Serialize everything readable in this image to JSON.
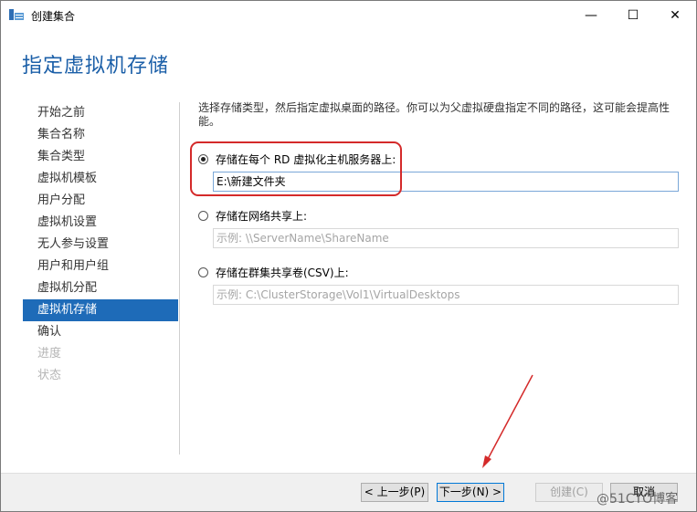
{
  "window": {
    "title": "创建集合",
    "minimize_glyph": "—",
    "maximize_glyph": "☐",
    "close_glyph": "✕"
  },
  "page_title": "指定虚拟机存储",
  "nav": {
    "items": [
      {
        "label": "开始之前",
        "state": "normal"
      },
      {
        "label": "集合名称",
        "state": "normal"
      },
      {
        "label": "集合类型",
        "state": "normal"
      },
      {
        "label": "虚拟机模板",
        "state": "normal"
      },
      {
        "label": "用户分配",
        "state": "normal"
      },
      {
        "label": "虚拟机设置",
        "state": "normal"
      },
      {
        "label": "无人参与设置",
        "state": "normal"
      },
      {
        "label": "用户和用户组",
        "state": "normal"
      },
      {
        "label": "虚拟机分配",
        "state": "normal"
      },
      {
        "label": "虚拟机存储",
        "state": "active"
      },
      {
        "label": "确认",
        "state": "normal"
      },
      {
        "label": "进度",
        "state": "disabled"
      },
      {
        "label": "状态",
        "state": "disabled"
      }
    ]
  },
  "content": {
    "description": "选择存储类型，然后指定虚拟桌面的路径。你可以为父虚拟硬盘指定不同的路径，这可能会提高性能。",
    "option_local": {
      "label": "存储在每个 RD 虚拟化主机服务器上:",
      "value": "E:\\新建文件夹",
      "checked": true
    },
    "option_share": {
      "label": "存储在网络共享上:",
      "placeholder": "示例: \\\\ServerName\\ShareName",
      "checked": false
    },
    "option_csv": {
      "label": "存储在群集共享卷(CSV)上:",
      "placeholder": "示例: C:\\ClusterStorage\\Vol1\\VirtualDesktops",
      "checked": false
    }
  },
  "buttons": {
    "prev": "< 上一步(P)",
    "next": "下一步(N) >",
    "create": "创建(C)",
    "cancel": "取消"
  },
  "watermark": "@51CTO博客",
  "colors": {
    "accent": "#1e6bb8",
    "title": "#1b5fa8",
    "annotation": "#d42a2a"
  }
}
